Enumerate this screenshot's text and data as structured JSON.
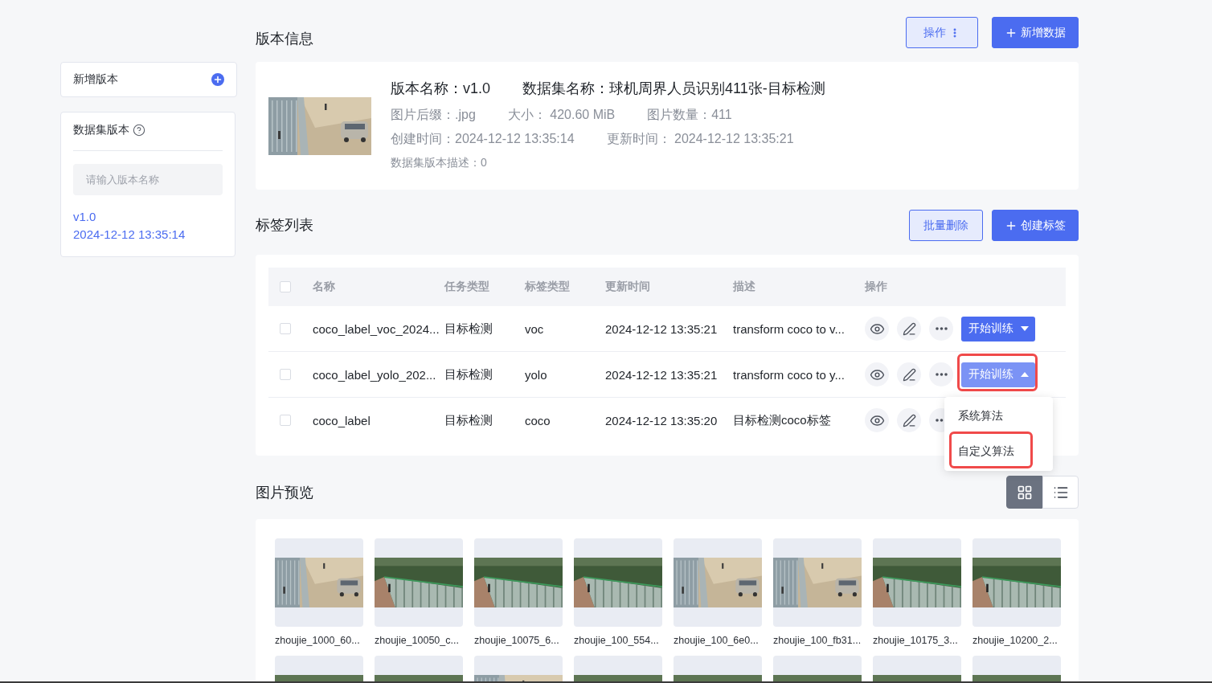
{
  "sidebar": {
    "add_version": {
      "label": "新增版本"
    },
    "versions_panel": {
      "title": "数据集版本",
      "search": {
        "placeholder": "请输入版本名称"
      },
      "versions": [
        {
          "name": "v1.0",
          "time": "2024-12-12 13:35:14",
          "selected": true
        }
      ]
    }
  },
  "version_info": {
    "title": "版本信息",
    "buttons": [
      {
        "label": "操作",
        "kind": "menu"
      },
      {
        "label": "新增数据",
        "kind": "add"
      }
    ],
    "thumbnail": {
      "kind": "yard"
    },
    "lines": [
      {
        "kind": "title",
        "items": [
          "版本名称：v1.0",
          "数据集名称：球机周界人员识别411张-目标检测"
        ]
      },
      {
        "kind": "meta",
        "items": [
          "图片后缀：.jpg",
          "大小： 420.60 MiB",
          "图片数量：411"
        ]
      },
      {
        "kind": "meta",
        "items": [
          "创建时间：2024-12-12 13:35:14",
          "更新时间： 2024-12-12 13:35:21"
        ]
      },
      {
        "kind": "note",
        "items": [
          "数据集版本描述：0"
        ]
      }
    ]
  },
  "label_list": {
    "title": "标签列表",
    "buttons": [
      {
        "label": "批量删除",
        "kind": "delete"
      },
      {
        "label": "创建标签",
        "kind": "add"
      }
    ],
    "table": {
      "select_all": {
        "checked": false
      },
      "columns": [
        "名称",
        "任务类型",
        "标签类型",
        "更新时间",
        "描述",
        "操作"
      ],
      "rows": [
        {
          "checked": false,
          "name": "coco_label_voc_2024...",
          "task_type": "目标检测",
          "label_type": "voc",
          "updated": "2024-12-12 13:35:21",
          "description": "transform coco to v...",
          "train": {
            "label": "开始训练",
            "open": false
          }
        },
        {
          "checked": false,
          "name": "coco_label_yolo_202...",
          "task_type": "目标检测",
          "label_type": "yolo",
          "updated": "2024-12-12 13:35:21",
          "description": "transform coco to y...",
          "train": {
            "label": "开始训练",
            "open": true,
            "highlighted": true,
            "menu": [
              {
                "label": "系统算法"
              },
              {
                "label": "自定义算法",
                "highlighted": true
              }
            ]
          }
        },
        {
          "checked": false,
          "name": "coco_label",
          "task_type": "目标检测",
          "label_type": "coco",
          "updated": "2024-12-12 13:35:20",
          "description": "目标检测coco标签"
        }
      ]
    }
  },
  "image_preview": {
    "title": "图片预览",
    "view_modes": [
      {
        "kind": "grid",
        "selected": true
      },
      {
        "kind": "list",
        "selected": false
      }
    ],
    "images": [
      {
        "kind": "yard",
        "caption": "zhoujie_1000_60..."
      },
      {
        "kind": "fence",
        "caption": "zhoujie_10050_c..."
      },
      {
        "kind": "fence",
        "caption": "zhoujie_10075_6..."
      },
      {
        "kind": "fence",
        "caption": "zhoujie_100_554..."
      },
      {
        "kind": "yard",
        "caption": "zhoujie_100_6e0..."
      },
      {
        "kind": "yard",
        "caption": "zhoujie_100_fb31..."
      },
      {
        "kind": "fence",
        "caption": "zhoujie_10175_3..."
      },
      {
        "kind": "fence",
        "caption": "zhoujie_10200_2..."
      },
      {
        "kind": "fence"
      },
      {
        "kind": "fence"
      },
      {
        "kind": "yard"
      },
      {
        "kind": "fence"
      },
      {
        "kind": "fence"
      },
      {
        "kind": "fence"
      },
      {
        "kind": "fence"
      },
      {
        "kind": "fence"
      }
    ]
  }
}
